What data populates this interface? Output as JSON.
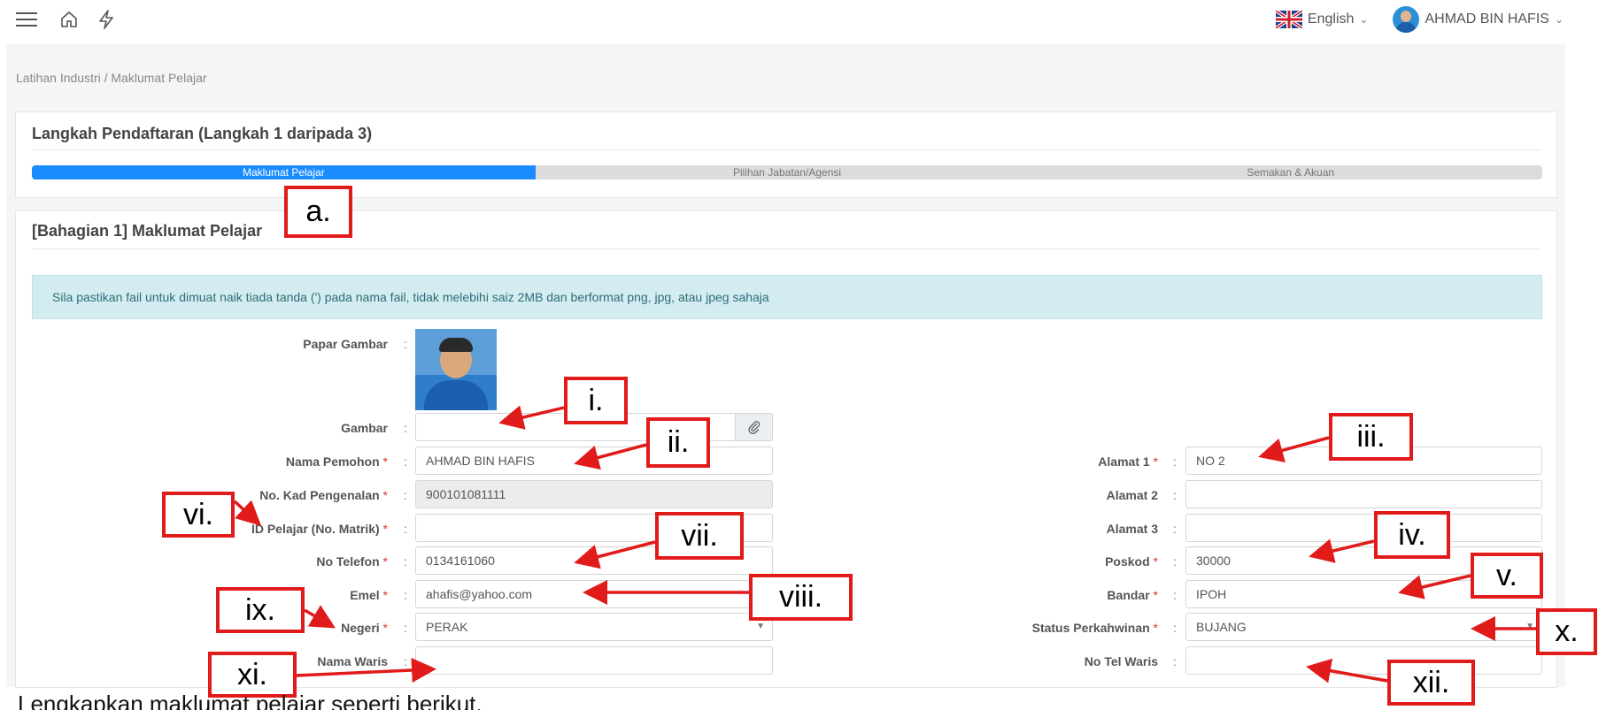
{
  "header": {
    "language": "English",
    "user_name": "AHMAD BIN HAFIS",
    "icons": [
      "menu-icon",
      "home-icon",
      "bolt-icon",
      "uk-flag-icon",
      "chevron-down-icon"
    ]
  },
  "breadcrumb": "Latihan Industri / Maklumat Pelajar",
  "registration": {
    "title": "Langkah Pendaftaran (Langkah 1 daripada 3)",
    "steps": [
      "Maklumat Pelajar",
      "Pilihan Jabatan/Agensi",
      "Semakan & Akuan"
    ],
    "current_step": 1
  },
  "section": {
    "title": "[Bahagian 1] Maklumat Pelajar",
    "notice": "Sila pastikan fail untuk dimuat naik tiada tanda (') pada nama fail, tidak melebihi saiz 2MB dan berformat png, jpg, atau jpeg sahaja"
  },
  "form": {
    "papar_gambar": "Papar Gambar",
    "gambar": {
      "label": "Gambar",
      "value": ""
    },
    "nama_pemohon": {
      "label": "Nama Pemohon",
      "value": "AHMAD BIN HAFIS"
    },
    "no_kp": {
      "label": "No. Kad Pengenalan",
      "value": "900101081111"
    },
    "id_pelajar": {
      "label": "ID Pelajar (No. Matrik)",
      "value": ""
    },
    "no_telefon": {
      "label": "No Telefon",
      "value": "0134161060"
    },
    "emel": {
      "label": "Emel",
      "value": "ahafis@yahoo.com"
    },
    "negeri": {
      "label": "Negeri",
      "value": "PERAK"
    },
    "nama_waris": {
      "label": "Nama Waris",
      "value": ""
    },
    "alamat1": {
      "label": "Alamat 1",
      "value": "NO 2"
    },
    "alamat2": {
      "label": "Alamat 2",
      "value": ""
    },
    "alamat3": {
      "label": "Alamat 3",
      "value": ""
    },
    "poskod": {
      "label": "Poskod",
      "value": "30000"
    },
    "bandar": {
      "label": "Bandar",
      "value": "IPOH"
    },
    "status_perkahwinan": {
      "label": "Status Perkahwinan",
      "value": "BUJANG"
    },
    "no_tel_waris": {
      "label": "No Tel Waris",
      "value": ""
    },
    "required_mark": "*",
    "colon": ":"
  },
  "annotations": {
    "a": "a.",
    "i": "i.",
    "ii": "ii.",
    "iii": "iii.",
    "iv": "iv.",
    "v": "v.",
    "vi": "vi.",
    "vii": "vii.",
    "viii": "viii.",
    "ix": "ix.",
    "x": "x.",
    "xi": "xi.",
    "xii": "xii.",
    "color": "#e11a1a"
  },
  "caption": "Lengkapkan maklumat pelajar seperti berikut."
}
